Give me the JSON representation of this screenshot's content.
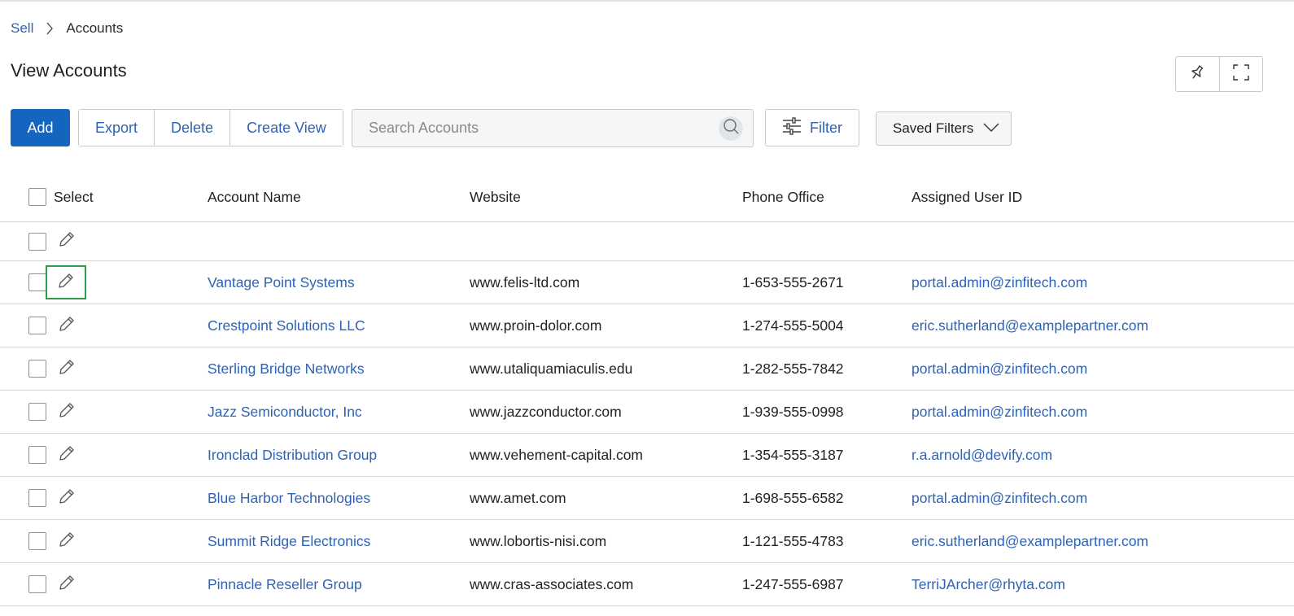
{
  "breadcrumb": {
    "parent": "Sell",
    "current": "Accounts"
  },
  "page": {
    "title": "View Accounts"
  },
  "view_tools": [
    {
      "name": "pin",
      "icon": "pin-icon"
    },
    {
      "name": "fullscreen",
      "icon": "expand-icon"
    }
  ],
  "toolbar": {
    "add_label": "Add",
    "export_label": "Export",
    "delete_label": "Delete",
    "create_view_label": "Create View",
    "search_placeholder": "Search Accounts",
    "search_value": "",
    "filter_label": "Filter",
    "saved_filters_label": "Saved Filters"
  },
  "table": {
    "headers": {
      "select": "Select",
      "name": "Account Name",
      "website": "Website",
      "phone": "Phone Office",
      "user": "Assigned User ID"
    },
    "rows": [
      {
        "name": "Vantage Point Systems",
        "website": "www.felis-ltd.com",
        "phone": "1-653-555-2671",
        "user": "portal.admin@zinfitech.com"
      },
      {
        "name": "Crestpoint Solutions LLC",
        "website": "www.proin-dolor.com",
        "phone": "1-274-555-5004",
        "user": "eric.sutherland@examplepartner.com"
      },
      {
        "name": "Sterling Bridge Networks",
        "website": "www.utaliquamiaculis.edu",
        "phone": "1-282-555-7842",
        "user": "portal.admin@zinfitech.com"
      },
      {
        "name": "Jazz Semiconductor, Inc",
        "website": "www.jazzconductor.com",
        "phone": "1-939-555-0998",
        "user": "portal.admin@zinfitech.com"
      },
      {
        "name": "Ironclad Distribution Group",
        "website": "www.vehement-capital.com",
        "phone": "1-354-555-3187",
        "user": "r.a.arnold@devify.com"
      },
      {
        "name": "Blue Harbor Technologies",
        "website": "www.amet.com",
        "phone": "1-698-555-6582",
        "user": "portal.admin@zinfitech.com"
      },
      {
        "name": "Summit Ridge Electronics",
        "website": "www.lobortis-nisi.com",
        "phone": "1-121-555-4783",
        "user": "eric.sutherland@examplepartner.com"
      },
      {
        "name": "Pinnacle Reseller Group",
        "website": "www.cras-associates.com",
        "phone": "1-247-555-6987",
        "user": "TerriJArcher@rhyta.com"
      }
    ]
  },
  "colors": {
    "accent": "#1565c0",
    "link": "#2e62b5",
    "focus": "#2e9d47"
  }
}
